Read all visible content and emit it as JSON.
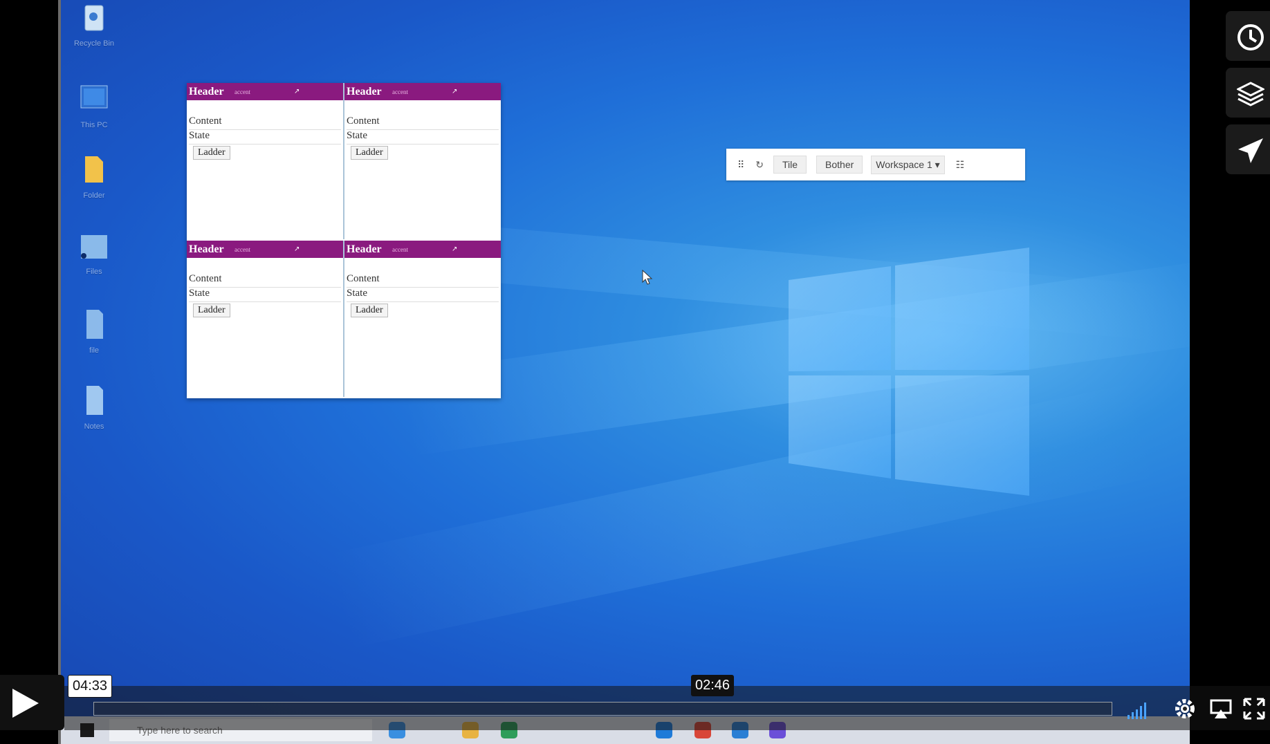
{
  "player": {
    "elapsed_time": "04:33",
    "hover_time": "02:46",
    "progress_fraction": 0.0
  },
  "desktop": {
    "icons": [
      {
        "name": "recycle-bin-icon",
        "label": "Recycle Bin"
      },
      {
        "name": "computer-icon",
        "label": "This PC"
      },
      {
        "name": "folder-icon",
        "label": "Folder"
      },
      {
        "name": "shared-folder-icon",
        "label": "Files"
      },
      {
        "name": "file-icon",
        "label": "file"
      },
      {
        "name": "document-icon",
        "label": "Notes"
      }
    ],
    "panes": [
      {
        "title": "Header",
        "tag": "accent",
        "content": "Content",
        "state": "State",
        "button": "Ladder"
      },
      {
        "title": "Header",
        "tag": "accent",
        "content": "Content",
        "state": "State",
        "button": "Ladder"
      },
      {
        "title": "Header",
        "tag": "accent",
        "content": "Content",
        "state": "State",
        "button": "Ladder"
      },
      {
        "title": "Header",
        "tag": "accent",
        "content": "Content",
        "state": "State",
        "button": "Ladder"
      }
    ],
    "toolbar": {
      "tile_label": "Tile",
      "bother_label": "Bother",
      "workspace_value": "Workspace 1"
    },
    "taskbar": {
      "search_placeholder": "Type here to search"
    }
  },
  "colors": {
    "pane_header": "#8a1a7f",
    "desktop_blue": "#1f6fd8"
  }
}
